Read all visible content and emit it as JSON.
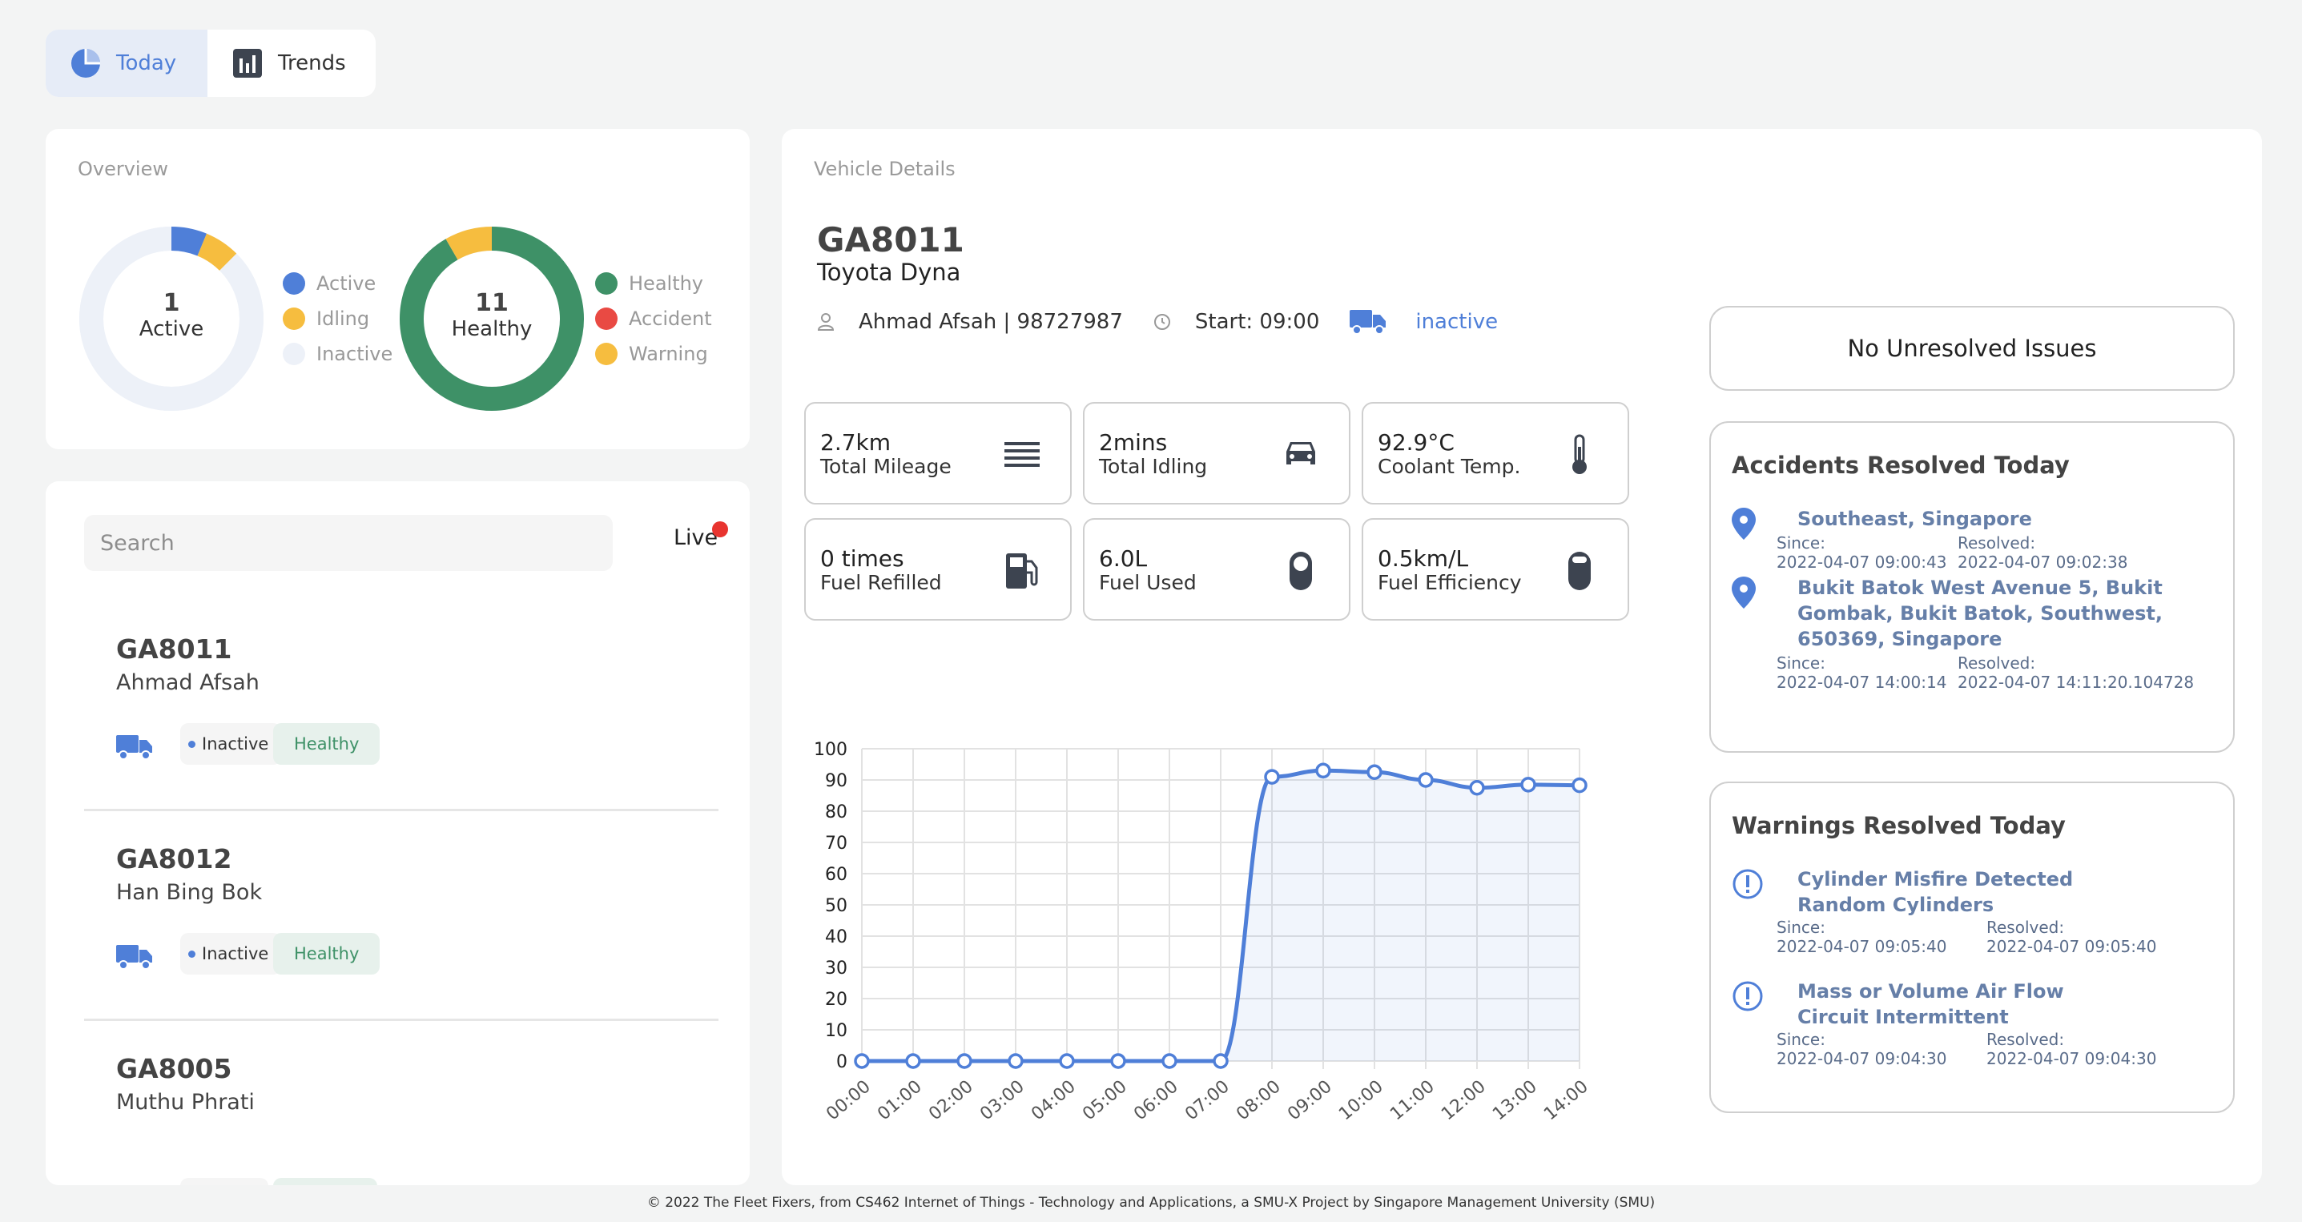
{
  "tabs": [
    {
      "label": "Today",
      "active": true,
      "icon": "pie-chart-icon"
    },
    {
      "label": "Trends",
      "active": false,
      "icon": "bar-chart-icon"
    }
  ],
  "overview": {
    "title": "Overview",
    "status_donut": {
      "count": "1",
      "label": "Active",
      "segments": [
        {
          "name": "Active",
          "value": 1,
          "color": "#4f7fd8"
        },
        {
          "name": "Idling",
          "value": 1,
          "color": "#f6bd3f"
        },
        {
          "name": "Inactive",
          "value": 14,
          "color": "#edf1f8"
        }
      ]
    },
    "status_legend": [
      "Active",
      "Idling",
      "Inactive"
    ],
    "health_donut": {
      "count": "11",
      "label": "Healthy",
      "segments": [
        {
          "name": "Healthy",
          "value": 11,
          "color": "#3e9167"
        },
        {
          "name": "Accident",
          "value": 0,
          "color": "#e94a43"
        },
        {
          "name": "Warning",
          "value": 1,
          "color": "#f6bd3f"
        }
      ]
    },
    "health_legend": [
      "Healthy",
      "Accident",
      "Warning"
    ]
  },
  "list": {
    "search_placeholder": "Search",
    "live_label": "Live",
    "vehicles": [
      {
        "plate": "GA8011",
        "driver": "Ahmad Afsah",
        "status": "Inactive",
        "health": "Healthy"
      },
      {
        "plate": "GA8012",
        "driver": "Han Bing Bok",
        "status": "Inactive",
        "health": "Healthy"
      },
      {
        "plate": "GA8005",
        "driver": "Muthu Phrati",
        "status": "",
        "health": ""
      }
    ]
  },
  "details": {
    "title": "Vehicle Details",
    "plate": "GA8011",
    "model": "Toyota Dyna",
    "driver": "Ahmad Afsah | 98727987",
    "start": "Start: 09:00",
    "status": "inactive",
    "metrics": [
      {
        "value": "2.7km",
        "label": "Total Mileage",
        "icon": "lines-icon"
      },
      {
        "value": "2mins",
        "label": "Total Idling",
        "icon": "car-icon"
      },
      {
        "value": "92.9°C",
        "label": "Coolant Temp.",
        "icon": "thermometer-icon"
      },
      {
        "value": "0 times",
        "label": "Fuel Refilled",
        "icon": "fuel-pump-icon"
      },
      {
        "value": "6.0L",
        "label": "Fuel Used",
        "icon": "fuel-level-icon"
      },
      {
        "value": "0.5km/L",
        "label": "Fuel Efficiency",
        "icon": "fuel-gauge-icon"
      }
    ]
  },
  "chart_data": {
    "type": "line",
    "x": [
      "00:00",
      "01:00",
      "02:00",
      "03:00",
      "04:00",
      "05:00",
      "06:00",
      "07:00",
      "08:00",
      "09:00",
      "10:00",
      "11:00",
      "12:00",
      "13:00",
      "14:00"
    ],
    "values": [
      0,
      0,
      0,
      0,
      0,
      0,
      0,
      0,
      91,
      93,
      92.5,
      90,
      87.5,
      88.5,
      88.3
    ],
    "ylim": [
      0,
      100
    ],
    "yticks": [
      0,
      10,
      20,
      30,
      40,
      50,
      60,
      70,
      80,
      90,
      100
    ],
    "grid": true,
    "color": "#4f7fd8"
  },
  "issues": {
    "no_unresolved": "No Unresolved Issues",
    "accidents_title": "Accidents Resolved Today",
    "accidents": [
      {
        "location": "Southeast, Singapore",
        "since_label": "Since:",
        "since": "2022-04-07 09:00:43",
        "resolved_label": "Resolved:",
        "resolved": "2022-04-07 09:02:38"
      },
      {
        "location": "Bukit Batok West Avenue 5, Bukit Gombak, Bukit Batok, Southwest, 650369, Singapore",
        "since_label": "Since:",
        "since": "2022-04-07 14:00:14",
        "resolved_label": "Resolved:",
        "resolved": "2022-04-07 14:11:20.104728"
      }
    ],
    "warnings_title": "Warnings Resolved Today",
    "warnings": [
      {
        "name": "Cylinder Misfire Detected Random Cylinders",
        "since_label": "Since:",
        "since": "2022-04-07 09:05:40",
        "resolved_label": "Resolved:",
        "resolved": "2022-04-07 09:05:40"
      },
      {
        "name": "Mass or Volume Air Flow Circuit Intermittent",
        "since_label": "Since:",
        "since": "2022-04-07 09:04:30",
        "resolved_label": "Resolved:",
        "resolved": "2022-04-07 09:04:30"
      }
    ]
  },
  "footer": "© 2022 The Fleet Fixers, from CS462 Internet of Things - Technology and Applications, a SMU-X Project by Singapore Management University (SMU)"
}
